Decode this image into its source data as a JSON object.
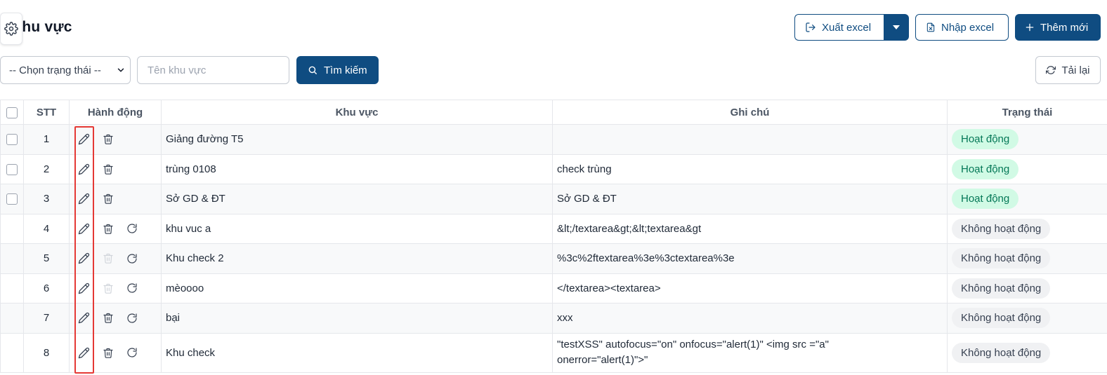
{
  "header": {
    "title": "Khu vực"
  },
  "toolbar": {
    "export_label": "Xuất excel",
    "import_label": "Nhập excel",
    "add_label": "Thêm mới"
  },
  "filters": {
    "status_select": "-- Chọn trạng thái --",
    "name_placeholder": "Tên khu vực",
    "search_label": "Tìm kiếm",
    "reload_label": "Tải lại"
  },
  "table": {
    "columns": [
      "STT",
      "Hành động",
      "Khu vực",
      "Ghi chú",
      "Trạng thái"
    ],
    "rows": [
      {
        "stt": "1",
        "area": "Giảng đường T5",
        "note": "",
        "status": "Hoạt động"
      },
      {
        "stt": "2",
        "area": "trùng 0108",
        "note": "check trùng",
        "status": "Hoạt động"
      },
      {
        "stt": "3",
        "area": "Sở GD & ĐT",
        "note": "Sở GD & ĐT",
        "status": "Hoạt động"
      },
      {
        "stt": "4",
        "area": "khu vuc a",
        "note": "&lt;/textarea&gt;&lt;textarea&gt",
        "status": "Không hoạt động"
      },
      {
        "stt": "5",
        "area": "Khu check 2",
        "note": "%3c%2ftextarea%3e%3ctextarea%3e",
        "status": "Không hoạt động"
      },
      {
        "stt": "6",
        "area": "mèoooo",
        "note": "</textarea><textarea>",
        "status": "Không hoạt động"
      },
      {
        "stt": "7",
        "area": "bại",
        "note": "xxx",
        "status": "Không hoạt động"
      },
      {
        "stt": "8",
        "area": "Khu check",
        "note_line1": "\"testXSS\" autofocus=\"on\" onfocus=\"alert(1)\" <img src =\"a\"",
        "note_line2": "onerror=\"alert(1)\">\"",
        "status": "Không hoạt động"
      }
    ]
  },
  "colors": {
    "primary": "#0f4c81",
    "active_bg": "#d1fae5",
    "active_text": "#047857",
    "inactive_bg": "#f0f1f3",
    "highlight": "#e53935"
  },
  "icons": {
    "settings": "gear-icon",
    "export": "export-icon",
    "import": "file-excel-icon",
    "add": "plus-icon",
    "search": "search-icon",
    "reload": "refresh-icon",
    "edit": "pencil-icon",
    "delete": "trash-icon",
    "restore": "restore-icon"
  }
}
